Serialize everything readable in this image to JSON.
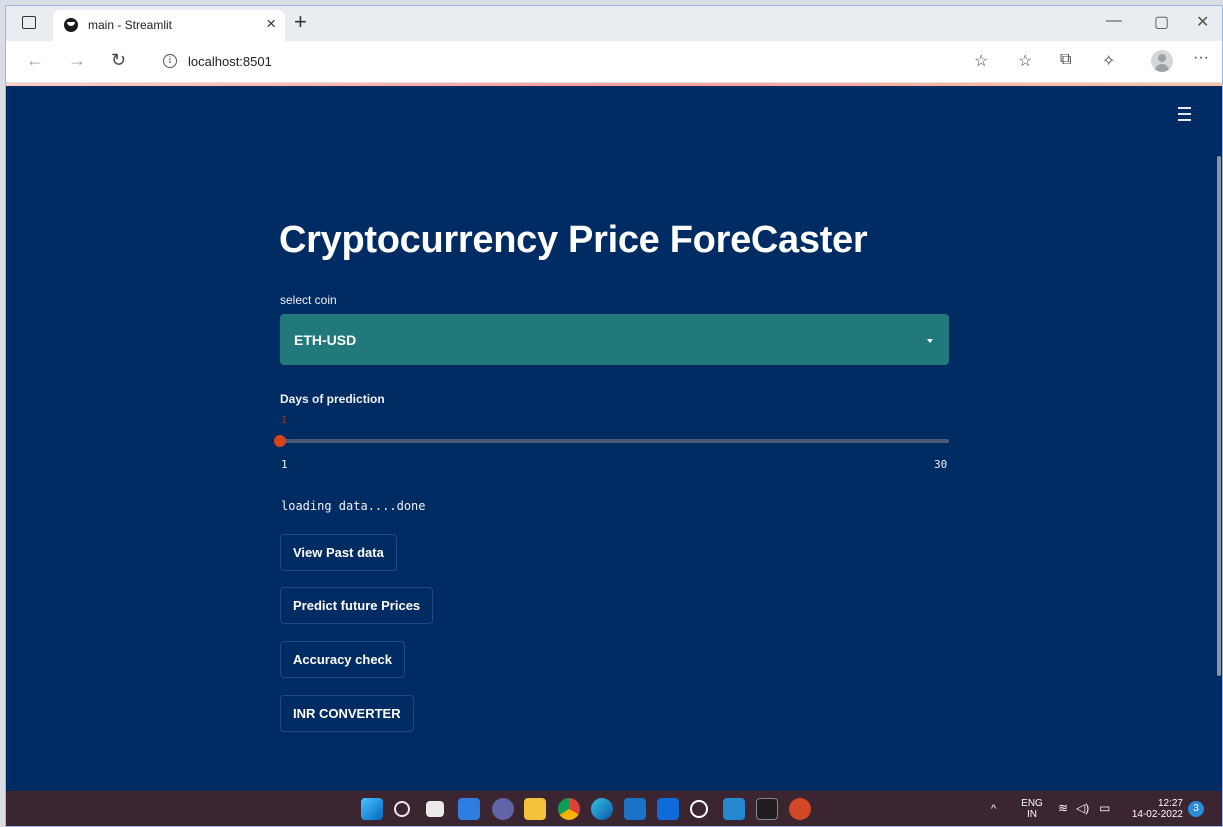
{
  "browser": {
    "tab_title": "main - Streamlit",
    "tab_close": "×",
    "new_tab": "+",
    "url": "localhost:8501",
    "info_glyph": "i",
    "minimize": "—",
    "maximize": "▢",
    "close": "✕",
    "more": "···"
  },
  "app": {
    "title": "Cryptocurrency Price ForeCaster",
    "select_label": "select coin",
    "selected_coin": "ETH-USD",
    "slider_label": "Days of prediction",
    "slider_value": 1,
    "slider_value_text": "1",
    "slider_min": 1,
    "slider_max": 30,
    "slider_min_text": "1",
    "slider_max_text": "30",
    "status_text": "loading data....done",
    "buttons": [
      {
        "label": "View Past data"
      },
      {
        "label": "Predict future Prices"
      },
      {
        "label": "Accuracy check"
      },
      {
        "label": "INR CONVERTER"
      }
    ]
  },
  "taskbar": {
    "lang_top": "ENG",
    "lang_bottom": "IN",
    "time": "12:27",
    "date": "14-02-2022",
    "notifications": "3",
    "chevron": "^"
  },
  "colors": {
    "app_bg": "#002b63",
    "select_bg": "#21797b",
    "slider_accent": "#d6461a"
  }
}
